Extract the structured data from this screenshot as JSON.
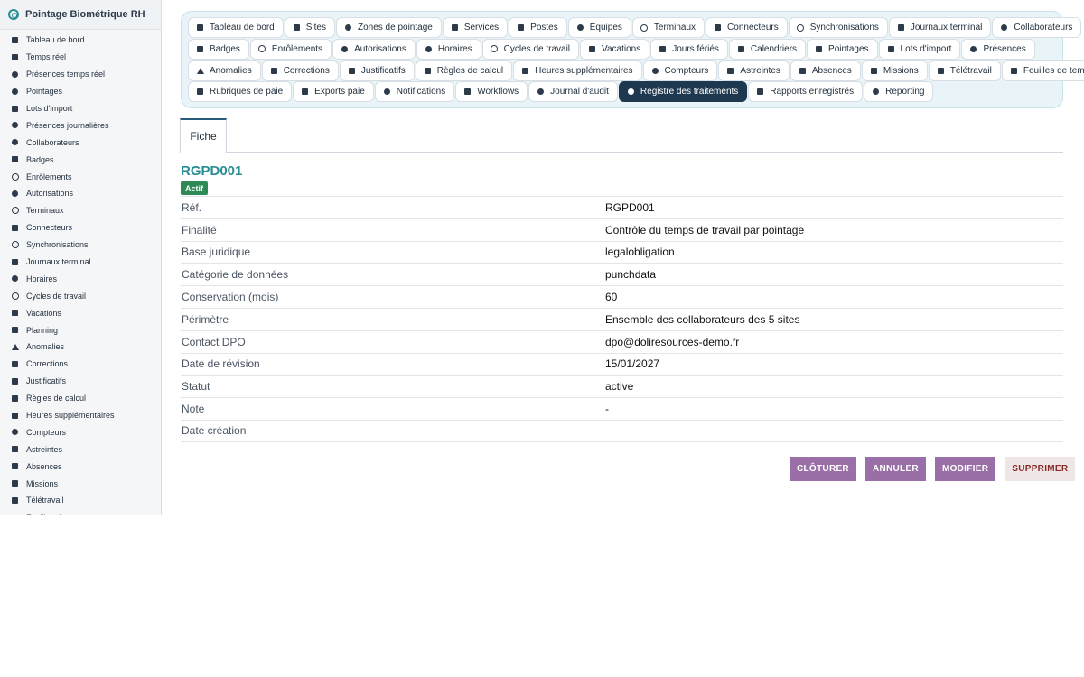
{
  "app": {
    "title": "Pointage Biométrique RH"
  },
  "sidebar": {
    "items": [
      {
        "label": "Tableau de bord",
        "icon": "dashboard-icon"
      },
      {
        "label": "Temps réel",
        "icon": "bolt-icon"
      },
      {
        "label": "Présences temps réel",
        "icon": "user-check-icon"
      },
      {
        "label": "Pointages",
        "icon": "clock-icon"
      },
      {
        "label": "Lots d'import",
        "icon": "file-import-icon"
      },
      {
        "label": "Présences journalières",
        "icon": "user-clock-icon"
      },
      {
        "label": "Collaborateurs",
        "icon": "users-icon"
      },
      {
        "label": "Badges",
        "icon": "badge-icon"
      },
      {
        "label": "Enrôlements",
        "icon": "fingerprint-icon"
      },
      {
        "label": "Autorisations",
        "icon": "user-lock-icon"
      },
      {
        "label": "Terminaux",
        "icon": "fingerprint-icon"
      },
      {
        "label": "Connecteurs",
        "icon": "plug-icon"
      },
      {
        "label": "Synchronisations",
        "icon": "sync-icon"
      },
      {
        "label": "Journaux terminal",
        "icon": "log-icon"
      },
      {
        "label": "Horaires",
        "icon": "clock-icon"
      },
      {
        "label": "Cycles de travail",
        "icon": "cycle-icon"
      },
      {
        "label": "Vacations",
        "icon": "calendar-icon"
      },
      {
        "label": "Planning",
        "icon": "calendar-icon"
      },
      {
        "label": "Anomalies",
        "icon": "warning-icon"
      },
      {
        "label": "Corrections",
        "icon": "edit-icon"
      },
      {
        "label": "Justificatifs",
        "icon": "paperclip-icon"
      },
      {
        "label": "Règles de calcul",
        "icon": "cogs-icon"
      },
      {
        "label": "Heures supplémentaires",
        "icon": "hourglass-icon"
      },
      {
        "label": "Compteurs",
        "icon": "gauge-icon"
      },
      {
        "label": "Astreintes",
        "icon": "phone-icon"
      },
      {
        "label": "Absences",
        "icon": "calendar-x-icon"
      },
      {
        "label": "Missions",
        "icon": "route-icon"
      },
      {
        "label": "Télétravail",
        "icon": "home-laptop-icon"
      },
      {
        "label": "Feuilles de temps",
        "icon": "table-icon"
      }
    ]
  },
  "tabs": {
    "rows": [
      [
        {
          "label": "Tableau de bord",
          "icon": "dashboard-icon"
        },
        {
          "label": "Sites",
          "icon": "building-icon"
        },
        {
          "label": "Zones de pointage",
          "icon": "map-pin-icon"
        },
        {
          "label": "Services",
          "icon": "sitemap-icon"
        },
        {
          "label": "Postes",
          "icon": "briefcase-icon"
        },
        {
          "label": "Équipes",
          "icon": "users-icon"
        },
        {
          "label": "Terminaux",
          "icon": "fingerprint-icon"
        },
        {
          "label": "Connecteurs",
          "icon": "plug-icon"
        },
        {
          "label": "Synchronisations",
          "icon": "sync-icon"
        },
        {
          "label": "Journaux terminal",
          "icon": "log-icon"
        },
        {
          "label": "Collaborateurs",
          "icon": "user-icon"
        }
      ],
      [
        {
          "label": "Badges",
          "icon": "badge-icon"
        },
        {
          "label": "Enrôlements",
          "icon": "fingerprint-icon"
        },
        {
          "label": "Autorisations",
          "icon": "user-lock-icon"
        },
        {
          "label": "Horaires",
          "icon": "clock-icon"
        },
        {
          "label": "Cycles de travail",
          "icon": "cycle-icon"
        },
        {
          "label": "Vacations",
          "icon": "calendar-icon"
        },
        {
          "label": "Jours fériés",
          "icon": "calendar-day-icon"
        },
        {
          "label": "Calendriers",
          "icon": "calendar-icon"
        },
        {
          "label": "Pointages",
          "icon": "sign-in-icon"
        },
        {
          "label": "Lots d'import",
          "icon": "file-import-icon"
        },
        {
          "label": "Présences",
          "icon": "user-check-icon"
        }
      ],
      [
        {
          "label": "Anomalies",
          "icon": "warning-icon"
        },
        {
          "label": "Corrections",
          "icon": "edit-icon"
        },
        {
          "label": "Justificatifs",
          "icon": "paperclip-icon"
        },
        {
          "label": "Règles de calcul",
          "icon": "cogs-icon"
        },
        {
          "label": "Heures supplémentaires",
          "icon": "hourglass-icon"
        },
        {
          "label": "Compteurs",
          "icon": "gauge-icon"
        },
        {
          "label": "Astreintes",
          "icon": "phone-icon"
        },
        {
          "label": "Absences",
          "icon": "calendar-x-icon"
        },
        {
          "label": "Missions",
          "icon": "route-icon"
        },
        {
          "label": "Télétravail",
          "icon": "home-laptop-icon"
        },
        {
          "label": "Feuilles de temps",
          "icon": "table-icon"
        }
      ],
      [
        {
          "label": "Rubriques de paie",
          "icon": "list-icon"
        },
        {
          "label": "Exports paie",
          "icon": "export-icon"
        },
        {
          "label": "Notifications",
          "icon": "bell-icon"
        },
        {
          "label": "Workflows",
          "icon": "workflow-icon"
        },
        {
          "label": "Journal d'audit",
          "icon": "history-icon"
        },
        {
          "label": "Registre des traitements",
          "icon": "user-shield-icon",
          "active": true
        },
        {
          "label": "Rapports enregistrés",
          "icon": "chart-icon"
        },
        {
          "label": "Reporting",
          "icon": "pie-chart-icon"
        }
      ]
    ]
  },
  "subtab": {
    "label": "Fiche"
  },
  "record": {
    "title": "RGPD001",
    "status_badge": "Actif",
    "fields": [
      {
        "label": "Réf.",
        "value": "RGPD001"
      },
      {
        "label": "Finalité",
        "value": "Contrôle du temps de travail par pointage"
      },
      {
        "label": "Base juridique",
        "value": "legalobligation"
      },
      {
        "label": "Catégorie de données",
        "value": "punchdata"
      },
      {
        "label": "Conservation (mois)",
        "value": "60"
      },
      {
        "label": "Périmètre",
        "value": "Ensemble des collaborateurs des 5 sites"
      },
      {
        "label": "Contact DPO",
        "value": "dpo@doliresources-demo.fr"
      },
      {
        "label": "Date de révision",
        "value": "15/01/2027"
      },
      {
        "label": "Statut",
        "value": "active"
      },
      {
        "label": "Note",
        "value": "-"
      },
      {
        "label": "Date création",
        "value": ""
      }
    ]
  },
  "actions": {
    "close_label": "CLÔTURER",
    "cancel_label": "ANNULER",
    "modify_label": "MODIFIER",
    "delete_label": "SUPPRIMER"
  },
  "colors": {
    "accent": "#2a8d94",
    "active_tab": "#1e3850",
    "badge": "#2e8b57",
    "action_button": "#9a6fa8",
    "delete_button": "#efe6e6"
  }
}
